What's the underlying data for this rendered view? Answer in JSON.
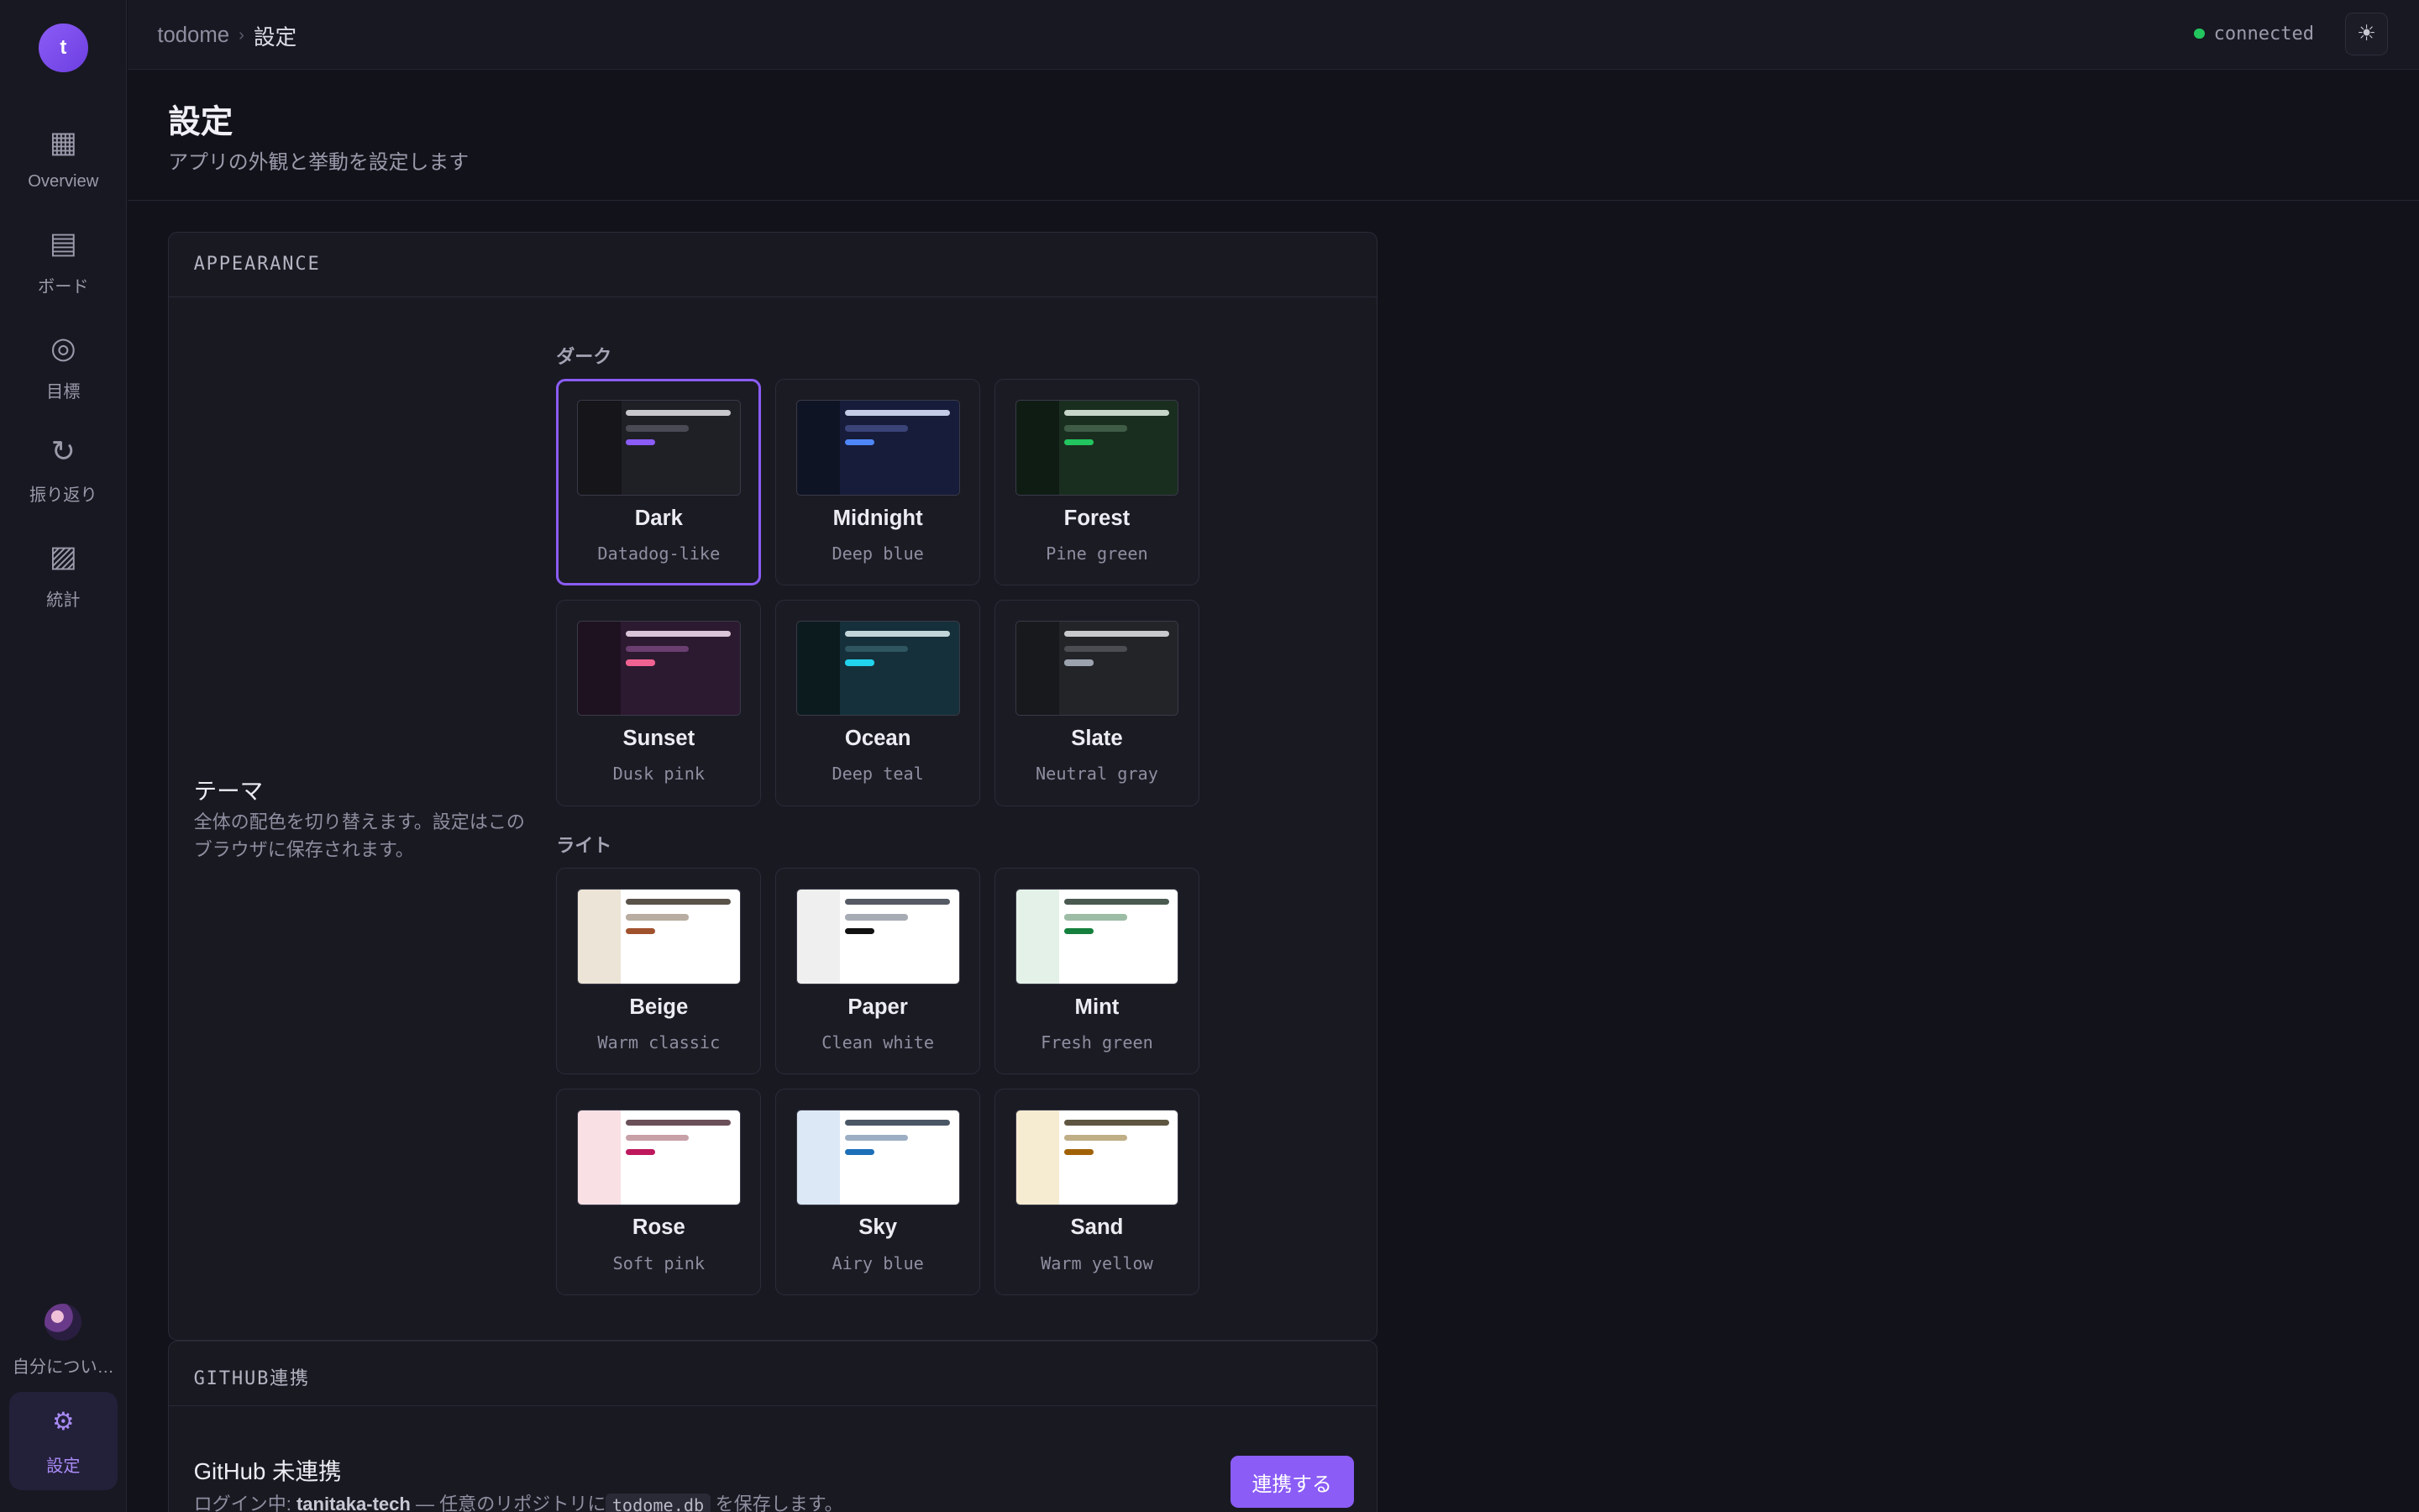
{
  "app": {
    "logo_letter": "t"
  },
  "sidebar": {
    "items": [
      {
        "label": "Overview",
        "icon": "▦"
      },
      {
        "label": "ボード",
        "icon": "▤"
      },
      {
        "label": "目標",
        "icon": "◎"
      },
      {
        "label": "振り返り",
        "icon": "↻"
      },
      {
        "label": "統計",
        "icon": "▨"
      }
    ],
    "profile_label": "自分につい…",
    "settings": {
      "label": "設定",
      "icon": "⚙"
    }
  },
  "topbar": {
    "breadcrumb": [
      "todome",
      "›",
      "設定"
    ],
    "status": "connected",
    "theme_toggle_icon": "☀"
  },
  "header": {
    "title": "設定",
    "subtitle": "アプリの外観と挙動を設定します"
  },
  "appearance": {
    "section_title": "APPEARANCE",
    "theme_label": "テーマ",
    "theme_desc": "全体の配色を切り替えます。設定はこのブラウザに保存されます。",
    "dark_title": "ダーク",
    "light_title": "ライト",
    "selected": "Dark",
    "themes": [
      {
        "name": "Dark",
        "desc": "Datadog-like",
        "side": "#15151a",
        "main": "#1f1f26",
        "b1": "#c8c8cc",
        "b2": "#4a4a55",
        "accent": "#8b5cf6"
      },
      {
        "name": "Midnight",
        "desc": "Deep blue",
        "side": "#0f1424",
        "main": "#161c3a",
        "b1": "#c4cbe6",
        "b2": "#3a4478",
        "accent": "#4f86f7"
      },
      {
        "name": "Forest",
        "desc": "Pine green",
        "side": "#0f1c14",
        "main": "#1a2e20",
        "b1": "#c6d6c8",
        "b2": "#3f5c46",
        "accent": "#22c55e"
      },
      {
        "name": "Sunset",
        "desc": "Dusk pink",
        "side": "#1e1220",
        "main": "#2c1a30",
        "b1": "#d9c4d8",
        "b2": "#6a3f70",
        "accent": "#f06292"
      },
      {
        "name": "Ocean",
        "desc": "Deep teal",
        "side": "#0c1c1e",
        "main": "#15303a",
        "b1": "#c2d6da",
        "b2": "#2f5660",
        "accent": "#22d3ee"
      },
      {
        "name": "Slate",
        "desc": "Neutral gray",
        "side": "#17191c",
        "main": "#222428",
        "b1": "#c8c9cc",
        "b2": "#4b4d52",
        "accent": "#9ca3af"
      },
      {
        "name": "Beige",
        "desc": "Warm classic",
        "side": "#ece4d6",
        "main": "#ffffff",
        "b1": "#5a534a",
        "b2": "#b8ada0",
        "accent": "#a0522d"
      },
      {
        "name": "Paper",
        "desc": "Clean white",
        "side": "#efefef",
        "main": "#ffffff",
        "b1": "#555a64",
        "b2": "#a7abb4",
        "accent": "#111111"
      },
      {
        "name": "Mint",
        "desc": "Fresh green",
        "side": "#e4f1e8",
        "main": "#ffffff",
        "b1": "#4a5a50",
        "b2": "#9dbca6",
        "accent": "#15803d"
      },
      {
        "name": "Rose",
        "desc": "Soft pink",
        "side": "#f9e0e4",
        "main": "#ffffff",
        "b1": "#6a5058",
        "b2": "#c8a0a8",
        "accent": "#be185d"
      },
      {
        "name": "Sky",
        "desc": "Airy blue",
        "side": "#dce8f6",
        "main": "#ffffff",
        "b1": "#4a5664",
        "b2": "#9caec4",
        "accent": "#1d6fb8"
      },
      {
        "name": "Sand",
        "desc": "Warm yellow",
        "side": "#f6ecd2",
        "main": "#ffffff",
        "b1": "#5e5640",
        "b2": "#bfae86",
        "accent": "#a16207"
      }
    ]
  },
  "github": {
    "section_title": "GITHUB連携",
    "status_title": "GitHub 未連携",
    "desc_prefix": "ログイン中: ",
    "user": "tanitaka-tech",
    "desc_mid": " — 任意のリポジトリに",
    "file": "todome.db",
    "desc_suffix": " を保存します。",
    "connect_label": "連携する"
  }
}
